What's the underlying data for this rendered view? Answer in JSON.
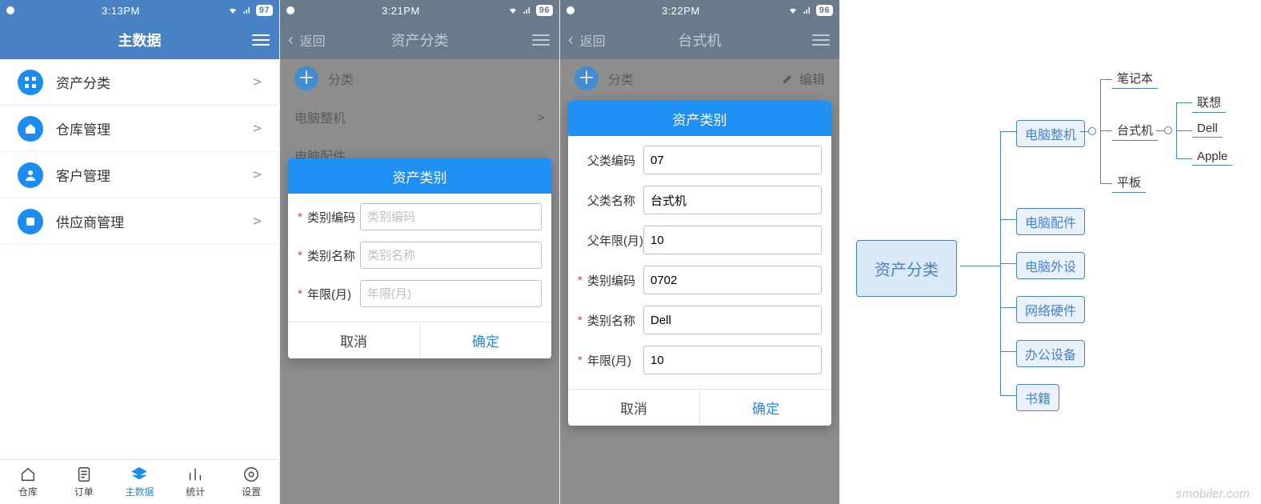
{
  "colors": {
    "primary": "#1d8cf0",
    "header": "#4882c5"
  },
  "screen1": {
    "time": "3:13PM",
    "battery": "97",
    "title": "主数据",
    "menu_items": [
      {
        "label": "资产分类"
      },
      {
        "label": "仓库管理"
      },
      {
        "label": "客户管理"
      },
      {
        "label": "供应商管理"
      }
    ],
    "tabbar": [
      {
        "label": "仓库"
      },
      {
        "label": "订单"
      },
      {
        "label": "主数据",
        "active": true
      },
      {
        "label": "统计"
      },
      {
        "label": "设置"
      }
    ]
  },
  "screen2": {
    "time": "3:21PM",
    "battery": "96",
    "back_label": "返回",
    "title": "资产分类",
    "bg_row_add": "分类",
    "bg_rows": [
      "电脑整机",
      "电脑配件"
    ],
    "modal": {
      "title": "资产类别",
      "fields": [
        {
          "required": true,
          "label": "类别编码",
          "placeholder": "类别编码",
          "value": ""
        },
        {
          "required": true,
          "label": "类别名称",
          "placeholder": "类别名称",
          "value": ""
        },
        {
          "required": true,
          "label": "年限(月)",
          "placeholder": "年限(月)",
          "value": ""
        }
      ],
      "cancel": "取消",
      "confirm": "确定"
    }
  },
  "screen3": {
    "time": "3:22PM",
    "battery": "96",
    "back_label": "返回",
    "title": "台式机",
    "bg_row_add": "分类",
    "bg_row_edit": "编辑",
    "modal": {
      "title": "资产类别",
      "fields": [
        {
          "required": false,
          "label": "父类编码",
          "value": "07"
        },
        {
          "required": false,
          "label": "父类名称",
          "value": "台式机"
        },
        {
          "required": false,
          "label": "父年限(月)",
          "value": "10"
        },
        {
          "required": true,
          "label": "类别编码",
          "value": "0702"
        },
        {
          "required": true,
          "label": "类别名称",
          "value": "Dell"
        },
        {
          "required": true,
          "label": "年限(月)",
          "value": "10"
        }
      ],
      "cancel": "取消",
      "confirm": "确定"
    }
  },
  "diagram": {
    "root": "资产分类",
    "branches": [
      "电脑整机",
      "电脑配件",
      "电脑外设",
      "网络硬件",
      "办公设备",
      "书籍"
    ],
    "sub_branches": [
      "笔记本",
      "台式机",
      "平板"
    ],
    "leaf_brands": [
      "联想",
      "Dell",
      "Apple"
    ],
    "watermark": "smobiler.com"
  }
}
